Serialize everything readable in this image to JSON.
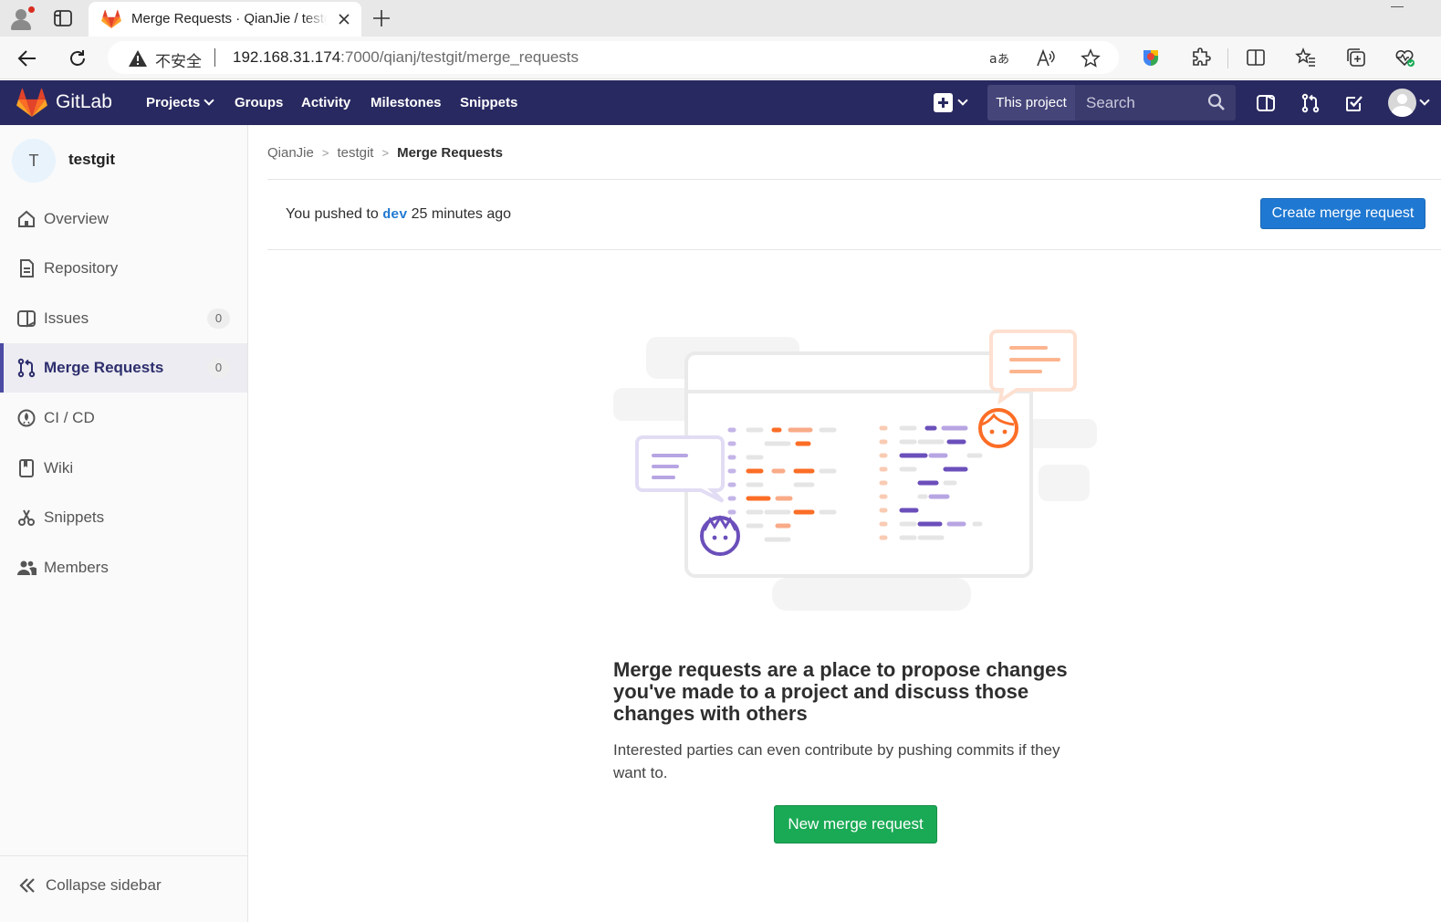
{
  "browser": {
    "tab_title": "Merge Requests · QianJie / testgit · GitLab",
    "insecure_label": "不安全",
    "url_host": "192.168.31.174",
    "url_rest": ":7000/qianj/testgit/merge_requests"
  },
  "header": {
    "brand": "GitLab",
    "nav": [
      "Projects",
      "Groups",
      "Activity",
      "Milestones",
      "Snippets"
    ],
    "search_scope": "This project",
    "search_placeholder": "Search"
  },
  "sidebar": {
    "project_initial": "T",
    "project_name": "testgit",
    "items": [
      {
        "label": "Overview",
        "icon": "home-icon"
      },
      {
        "label": "Repository",
        "icon": "repository-icon"
      },
      {
        "label": "Issues",
        "icon": "issues-icon",
        "count": "0"
      },
      {
        "label": "Merge Requests",
        "icon": "merge-request-icon",
        "count": "0",
        "active": true
      },
      {
        "label": "CI / CD",
        "icon": "rocket-icon"
      },
      {
        "label": "Wiki",
        "icon": "book-icon"
      },
      {
        "label": "Snippets",
        "icon": "scissors-icon"
      },
      {
        "label": "Members",
        "icon": "users-icon"
      }
    ],
    "collapse_label": "Collapse sidebar"
  },
  "breadcrumb": [
    "QianJie",
    "testgit",
    "Merge Requests"
  ],
  "push_notice": {
    "prefix": "You pushed to",
    "branch": "dev",
    "suffix": "25 minutes ago",
    "button": "Create merge request"
  },
  "empty_state": {
    "title": "Merge requests are a place to propose changes you've made to a project and discuss those changes with others",
    "description": "Interested parties can even contribute by pushing commits if they want to.",
    "button": "New merge request"
  },
  "colors": {
    "header_bg": "#292961",
    "primary_blue": "#1f78d1",
    "success_green": "#1aaa55",
    "illustration_orange": "#fc6d26",
    "illustration_purple": "#6b4fbb"
  }
}
